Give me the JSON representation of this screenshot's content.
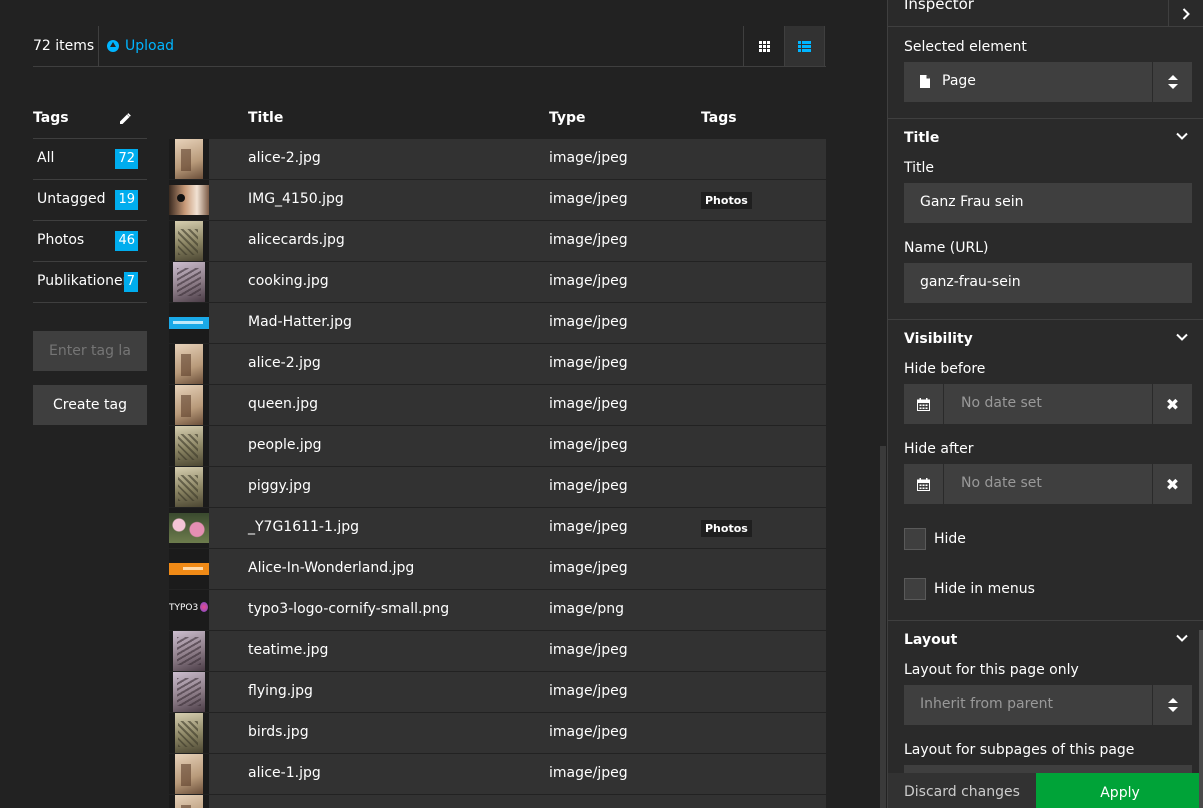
{
  "toolbar": {
    "item_count": "72 items",
    "upload_label": "Upload"
  },
  "tags_panel": {
    "header": "Tags",
    "items": [
      {
        "name": "All",
        "count": "72"
      },
      {
        "name": "Untagged",
        "count": "19"
      },
      {
        "name": "Photos",
        "count": "46"
      },
      {
        "name": "Publikationen",
        "count": "7"
      }
    ],
    "input_placeholder": "Enter tag label",
    "create_label": "Create tag"
  },
  "files": {
    "columns": {
      "title": "Title",
      "type": "Type",
      "tags": "Tags"
    },
    "rows": [
      {
        "title": "alice-2.jpg",
        "type": "image/jpeg",
        "tag": "",
        "thumb": "sepia"
      },
      {
        "title": "IMG_4150.jpg",
        "type": "image/jpeg",
        "tag": "Photos",
        "thumb": "photo-deer"
      },
      {
        "title": "alicecards.jpg",
        "type": "image/jpeg",
        "tag": "",
        "thumb": "sepia-green"
      },
      {
        "title": "cooking.jpg",
        "type": "image/jpeg",
        "tag": "",
        "thumb": "sepia-purple"
      },
      {
        "title": "Mad-Hatter.jpg",
        "type": "image/jpeg",
        "tag": "",
        "thumb": "blue-banner"
      },
      {
        "title": "alice-2.jpg",
        "type": "image/jpeg",
        "tag": "",
        "thumb": "sepia"
      },
      {
        "title": "queen.jpg",
        "type": "image/jpeg",
        "tag": "",
        "thumb": "sepia"
      },
      {
        "title": "people.jpg",
        "type": "image/jpeg",
        "tag": "",
        "thumb": "sepia-green"
      },
      {
        "title": "piggy.jpg",
        "type": "image/jpeg",
        "tag": "",
        "thumb": "sepia-green"
      },
      {
        "title": "_Y7G1611-1.jpg",
        "type": "image/jpeg",
        "tag": "Photos",
        "thumb": "photo-flowers"
      },
      {
        "title": "Alice-In-Wonderland.jpg",
        "type": "image/jpeg",
        "tag": "",
        "thumb": "orange-banner"
      },
      {
        "title": "typo3-logo-cornify-small.png",
        "type": "image/png",
        "tag": "",
        "thumb": "typo3-logo"
      },
      {
        "title": "teatime.jpg",
        "type": "image/jpeg",
        "tag": "",
        "thumb": "sepia-purple"
      },
      {
        "title": "flying.jpg",
        "type": "image/jpeg",
        "tag": "",
        "thumb": "sepia-purple"
      },
      {
        "title": "birds.jpg",
        "type": "image/jpeg",
        "tag": "",
        "thumb": "sepia-green"
      },
      {
        "title": "alice-1.jpg",
        "type": "image/jpeg",
        "tag": "",
        "thumb": "sepia"
      },
      {
        "title": "",
        "type": "",
        "tag": "",
        "thumb": "sepia"
      }
    ]
  },
  "inspector": {
    "header": "Inspector",
    "selected_element_label": "Selected element",
    "selected_element_value": "Page",
    "title_section": "Title",
    "title_label": "Title",
    "title_value": "Ganz Frau sein",
    "name_label": "Name (URL)",
    "name_value": "ganz-frau-sein",
    "visibility_section": "Visibility",
    "hide_before_label": "Hide before",
    "hide_before_value": "No date set",
    "hide_after_label": "Hide after",
    "hide_after_value": "No date set",
    "hide_label": "Hide",
    "hide_in_menus_label": "Hide in menus",
    "layout_section": "Layout",
    "layout_page_label": "Layout for this page only",
    "layout_page_value": "Inherit from parent",
    "layout_subpages_label": "Layout for subpages of this page",
    "discard_label": "Discard changes",
    "apply_label": "Apply"
  },
  "colors": {
    "accent": "#00b5ff",
    "badge": "#00adee",
    "apply": "#00a338",
    "background": "#222222",
    "panel": "#2a2a2a"
  }
}
